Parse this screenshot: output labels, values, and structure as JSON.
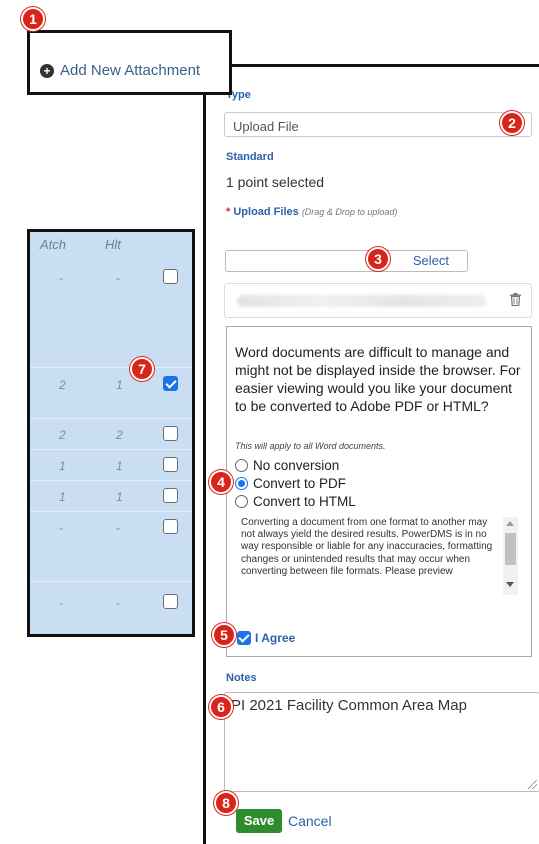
{
  "attachment": {
    "add_label": "Add New Attachment"
  },
  "grid": {
    "col_atch": "Atch",
    "col_hlt": "Hlt",
    "rows": [
      {
        "atch": "-",
        "hlt": "-",
        "checked": false
      },
      {
        "atch": "2",
        "hlt": "1",
        "checked": true
      },
      {
        "atch": "2",
        "hlt": "2",
        "checked": false
      },
      {
        "atch": "1",
        "hlt": "1",
        "checked": false
      },
      {
        "atch": "1",
        "hlt": "1",
        "checked": false
      },
      {
        "atch": "-",
        "hlt": "-",
        "checked": false
      },
      {
        "atch": "-",
        "hlt": "-",
        "checked": false
      }
    ]
  },
  "form": {
    "type_label": "Type",
    "type_value": "Upload File",
    "standard_label": "Standard",
    "standard_value": "1 point selected",
    "upload_required": "*",
    "upload_label": "Upload Files",
    "upload_hint": "(Drag & Drop to upload)",
    "select_label": "Select",
    "conversion": {
      "message": "Word documents are difficult to manage and might not be displayed inside the browser. For easier viewing would you like your document to be converted to Adobe PDF or HTML?",
      "note": "This will apply to all Word documents.",
      "options": [
        "No conversion",
        "Convert to PDF",
        "Convert to HTML"
      ],
      "selected": "Convert to PDF",
      "disclaimer": "Converting a document from one format to another may not always yield the desired results. PowerDMS is in no way responsible or liable for any inaccuracies, formatting changes or unintended results that may occur when converting between file formats. Please preview",
      "agree_label": "I Agree"
    },
    "notes_label": "Notes",
    "notes_value": "PI 2021 Facility Common Area Map",
    "save_label": "Save",
    "cancel_label": "Cancel"
  },
  "badges": [
    "1",
    "2",
    "3",
    "4",
    "5",
    "6",
    "7",
    "8"
  ],
  "colors": {
    "accent_blue": "#2b62a8",
    "save_green": "#2e8b2e",
    "badge_red": "#d9241c",
    "grid_bg": "#c9def3"
  }
}
